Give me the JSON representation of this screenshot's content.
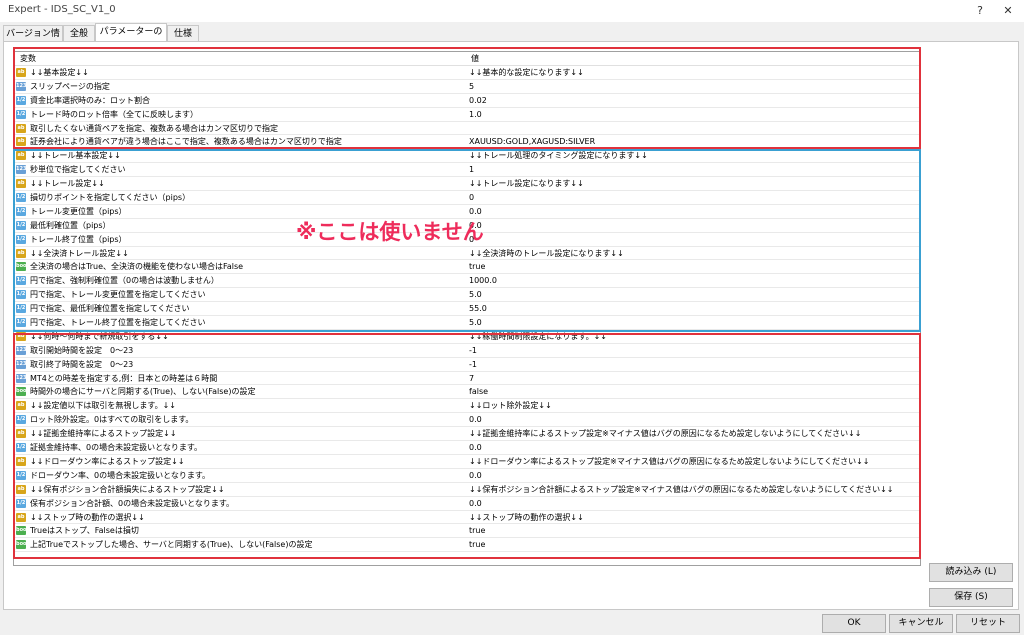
{
  "window": {
    "title": "Expert - IDS_SC_V1_0",
    "help": "?",
    "close": "✕"
  },
  "tabs": [
    {
      "label": "バージョン情報"
    },
    {
      "label": "全般"
    },
    {
      "label": "パラメーターの入力"
    },
    {
      "label": "仕様"
    }
  ],
  "grid": {
    "col_variable": "変数",
    "col_value": "値",
    "rows": [
      {
        "icon": "ab",
        "name": "↓↓基本設定↓↓",
        "value": "↓↓基本的な設定になります↓↓"
      },
      {
        "icon": "123",
        "name": "スリップページの指定",
        "value": "5"
      },
      {
        "icon": "1/2",
        "name": "資金比率選択時のみ：ロット割合",
        "value": "0.02"
      },
      {
        "icon": "1/2",
        "name": "トレード時のロット倍率（全てに反映します）",
        "value": "1.0"
      },
      {
        "icon": "ab",
        "name": "取引したくない通貨ペアを指定、複数ある場合はカンマ区切りで指定",
        "value": ""
      },
      {
        "icon": "ab",
        "name": "証券会社により通貨ペアが違う場合はここで指定、複数ある場合はカンマ区切りで指定",
        "value": "XAUUSD:GOLD,XAGUSD:SILVER"
      },
      {
        "icon": "ab",
        "name": "↓↓トレール基本設定↓↓",
        "value": "↓↓トレール処理のタイミング設定になります↓↓"
      },
      {
        "icon": "123",
        "name": "秒単位で指定してください",
        "value": "1"
      },
      {
        "icon": "ab",
        "name": "↓↓トレール設定↓↓",
        "value": "↓↓トレール設定になります↓↓"
      },
      {
        "icon": "1/2",
        "name": "損切りポイントを指定してください（pips）",
        "value": "0"
      },
      {
        "icon": "1/2",
        "name": "トレール変更位置（pips）",
        "value": "0.0"
      },
      {
        "icon": "1/2",
        "name": "最低利確位置（pips）",
        "value": "0.0"
      },
      {
        "icon": "1/2",
        "name": "トレール終了位置（pips）",
        "value": "0"
      },
      {
        "icon": "ab",
        "name": "↓↓全決済トレール設定↓↓",
        "value": "↓↓全決済時のトレール設定になります↓↓"
      },
      {
        "icon": "bool",
        "name": "全決済の場合はTrue、全決済の機能を使わない場合はFalse",
        "value": "true"
      },
      {
        "icon": "1/2",
        "name": "円で指定、強制利確位置（0の場合は波動しません）",
        "value": "1000.0"
      },
      {
        "icon": "1/2",
        "name": "円で指定、トレール変更位置を指定してください",
        "value": "5.0"
      },
      {
        "icon": "1/2",
        "name": "円で指定、最低利確位置を指定してください",
        "value": "55.0"
      },
      {
        "icon": "1/2",
        "name": "円で指定、トレール終了位置を指定してください",
        "value": "5.0"
      },
      {
        "icon": "ab",
        "name": "↓↓何時～何時まで新規取引をする↓↓",
        "value": "↓↓稼働時間制限設定になります。↓↓"
      },
      {
        "icon": "123",
        "name": "取引開始時間を設定　0～23",
        "value": "-1"
      },
      {
        "icon": "123",
        "name": "取引終了時間を設定　0～23",
        "value": "-1"
      },
      {
        "icon": "123",
        "name": "MT4との時差を指定する,例：日本との時差は６時間",
        "value": "7"
      },
      {
        "icon": "bool",
        "name": "時間外の場合にサーバと同期する(True)、しない(False)の設定",
        "value": "false"
      },
      {
        "icon": "ab",
        "name": "↓↓設定値以下は取引を無視します。↓↓",
        "value": "↓↓ロット除外設定↓↓"
      },
      {
        "icon": "1/2",
        "name": "ロット除外設定。0はすべての取引をします。",
        "value": "0.0"
      },
      {
        "icon": "ab",
        "name": "↓↓証拠金維持率によるストップ設定↓↓",
        "value": "↓↓証拠金維持率によるストップ設定※マイナス値はバグの原因になるため設定しないようにしてください↓↓"
      },
      {
        "icon": "1/2",
        "name": "証拠金維持率、0の場合未設定扱いとなります。",
        "value": "0.0"
      },
      {
        "icon": "ab",
        "name": "↓↓ドローダウン率によるストップ設定↓↓",
        "value": "↓↓ドローダウン率によるストップ設定※マイナス値はバグの原因になるため設定しないようにしてください↓↓"
      },
      {
        "icon": "1/2",
        "name": "ドローダウン率、0の場合未設定扱いとなります。",
        "value": "0.0"
      },
      {
        "icon": "ab",
        "name": "↓↓保有ポジション合計額損失によるストップ設定↓↓",
        "value": "↓↓保有ポジション合計額によるストップ設定※マイナス値はバグの原因になるため設定しないようにしてください↓↓"
      },
      {
        "icon": "1/2",
        "name": "保有ポジション合計額、0の場合未設定扱いとなります。",
        "value": "0.0"
      },
      {
        "icon": "ab",
        "name": "↓↓ストップ時の動作の選択↓↓",
        "value": "↓↓ストップ時の動作の選択↓↓"
      },
      {
        "icon": "bool",
        "name": "Trueはストップ、Falseは損切",
        "value": "true"
      },
      {
        "icon": "bool",
        "name": "上記Trueでストップした場合、サーバと同期する(True)、しない(False)の設定",
        "value": "true"
      }
    ]
  },
  "overlay_text": "※ここは使いません",
  "side_buttons": {
    "load": "読み込み (L)",
    "save": "保存 (S)"
  },
  "bottom_buttons": {
    "ok": "OK",
    "cancel": "キャンセル",
    "reset": "リセット"
  },
  "colors": {
    "red_box": "#e0323c",
    "blue_box": "#3aa0d2",
    "overlay": "#ee2c5b"
  }
}
